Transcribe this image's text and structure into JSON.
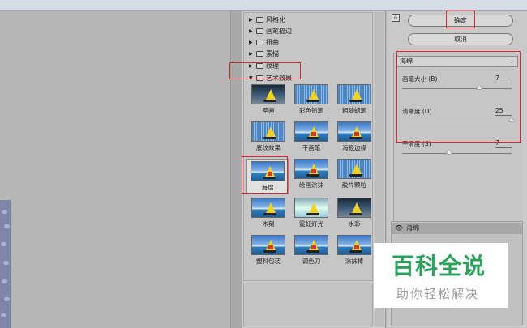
{
  "tree": {
    "categories": [
      {
        "label": "风格化",
        "arrow": "▶"
      },
      {
        "label": "画笔描边",
        "arrow": "▶"
      },
      {
        "label": "扭曲",
        "arrow": "▶"
      },
      {
        "label": "素描",
        "arrow": "▶"
      },
      {
        "label": "纹理",
        "arrow": "▶"
      },
      {
        "label": "艺术效果",
        "arrow": "▼"
      }
    ],
    "filters": [
      {
        "label": "壁画"
      },
      {
        "label": "彩色铅笔"
      },
      {
        "label": "粗糙蜡笔"
      },
      {
        "label": "底纹效果"
      },
      {
        "label": "干画笔"
      },
      {
        "label": "海报边缘"
      },
      {
        "label": "海绵"
      },
      {
        "label": "绘画涂抹"
      },
      {
        "label": "胶片颗粒"
      },
      {
        "label": "木刻"
      },
      {
        "label": "霓虹灯光"
      },
      {
        "label": "水彩"
      },
      {
        "label": "塑料包装"
      },
      {
        "label": "调色刀"
      },
      {
        "label": "涂抹棒"
      }
    ]
  },
  "right": {
    "help_icon": "⌂",
    "ok_label": "确定",
    "cancel_label": "取消",
    "filter_select": "海绵",
    "params": [
      {
        "label": "画笔大小 (B)",
        "value": "7",
        "level": 0.7
      },
      {
        "label": "清晰度 (D)",
        "value": "25",
        "level": 1.0
      },
      {
        "label": "平滑度 (S)",
        "value": "7",
        "level": 0.43
      }
    ],
    "layer_name": "海绵",
    "layer_eye": "👁"
  },
  "watermark": {
    "title": "百科全说",
    "subtitle": "助你轻松解决"
  },
  "colors": {
    "highlight": "#e0242f",
    "watermark_green": "#29a35a"
  }
}
